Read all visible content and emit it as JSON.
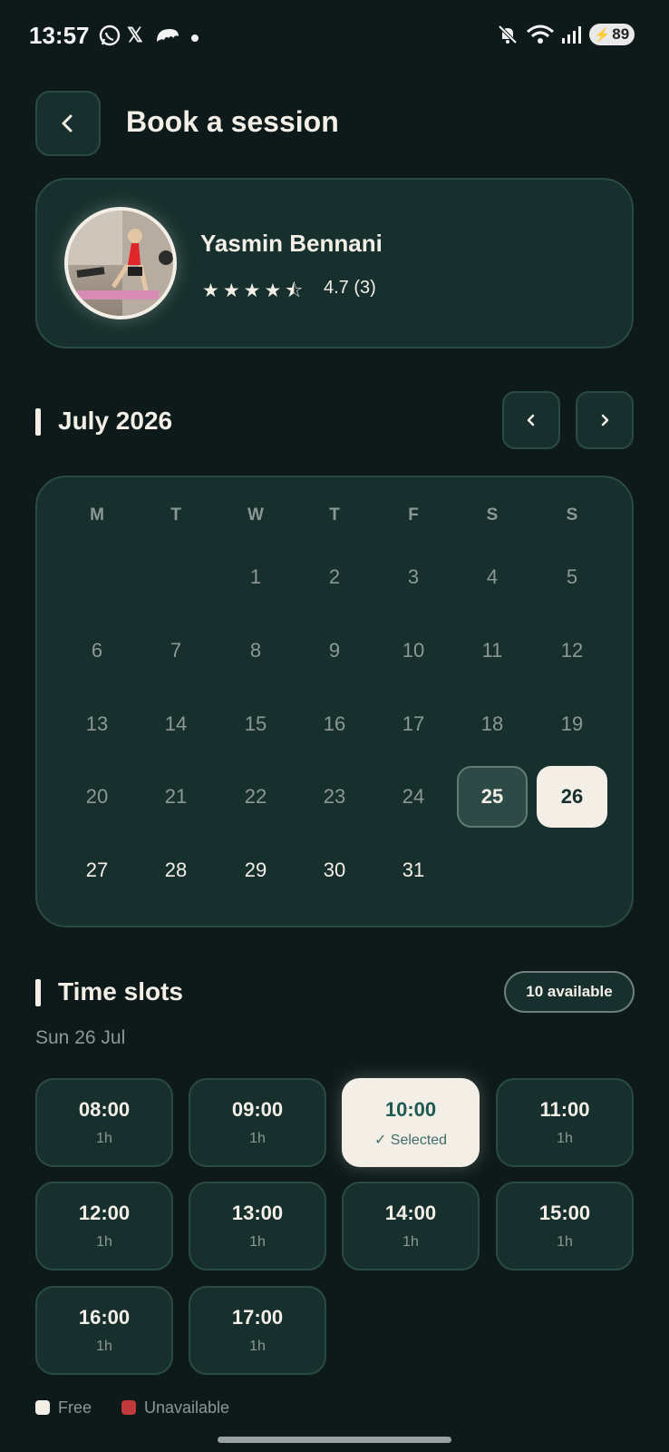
{
  "status_bar": {
    "time": "13:57",
    "battery": "89",
    "icons": [
      "whatsapp-icon",
      "x-icon",
      "cloud-icon",
      "dot-icon",
      "mute-icon",
      "wifi-icon",
      "signal-icon",
      "battery-icon"
    ]
  },
  "header": {
    "title": "Book a session",
    "back_icon": "chevron-left-icon"
  },
  "trainer": {
    "name": "Yasmin Bennani",
    "stars": "★★★★⯪",
    "rating": "4.7 (3)"
  },
  "calendar": {
    "month": "July 2026",
    "weekdays": [
      "M",
      "T",
      "W",
      "T",
      "F",
      "S",
      "S"
    ],
    "rows": [
      [
        "",
        "",
        "1",
        "2",
        "3",
        "4",
        "5"
      ],
      [
        "6",
        "7",
        "8",
        "9",
        "10",
        "11",
        "12"
      ],
      [
        "13",
        "14",
        "15",
        "16",
        "17",
        "18",
        "19"
      ],
      [
        "20",
        "21",
        "22",
        "23",
        "24",
        "25",
        "26"
      ],
      [
        "27",
        "28",
        "29",
        "30",
        "31",
        "",
        ""
      ]
    ],
    "today": "25",
    "selected": "26"
  },
  "time_slots": {
    "title": "Time slots",
    "available_badge": "10 available",
    "date": "Sun 26 Jul",
    "slots": [
      {
        "time": "08:00",
        "duration": "1h"
      },
      {
        "time": "09:00",
        "duration": "1h"
      },
      {
        "time": "10:00",
        "duration": "✓ Selected"
      },
      {
        "time": "11:00",
        "duration": "1h"
      },
      {
        "time": "12:00",
        "duration": "1h"
      },
      {
        "time": "13:00",
        "duration": "1h"
      },
      {
        "time": "14:00",
        "duration": "1h"
      },
      {
        "time": "15:00",
        "duration": "1h"
      },
      {
        "time": "16:00",
        "duration": "1h"
      },
      {
        "time": "17:00",
        "duration": "1h"
      }
    ]
  },
  "legend": {
    "free": "Free",
    "unavailable": "Unavailable",
    "free_color": "#f3efe7",
    "unavailable_color": "#c0393b"
  },
  "colors": {
    "background": "#0d1a19",
    "card": "#17302d",
    "accent": "#f3efe7",
    "selected_text": "#1f5a52"
  }
}
